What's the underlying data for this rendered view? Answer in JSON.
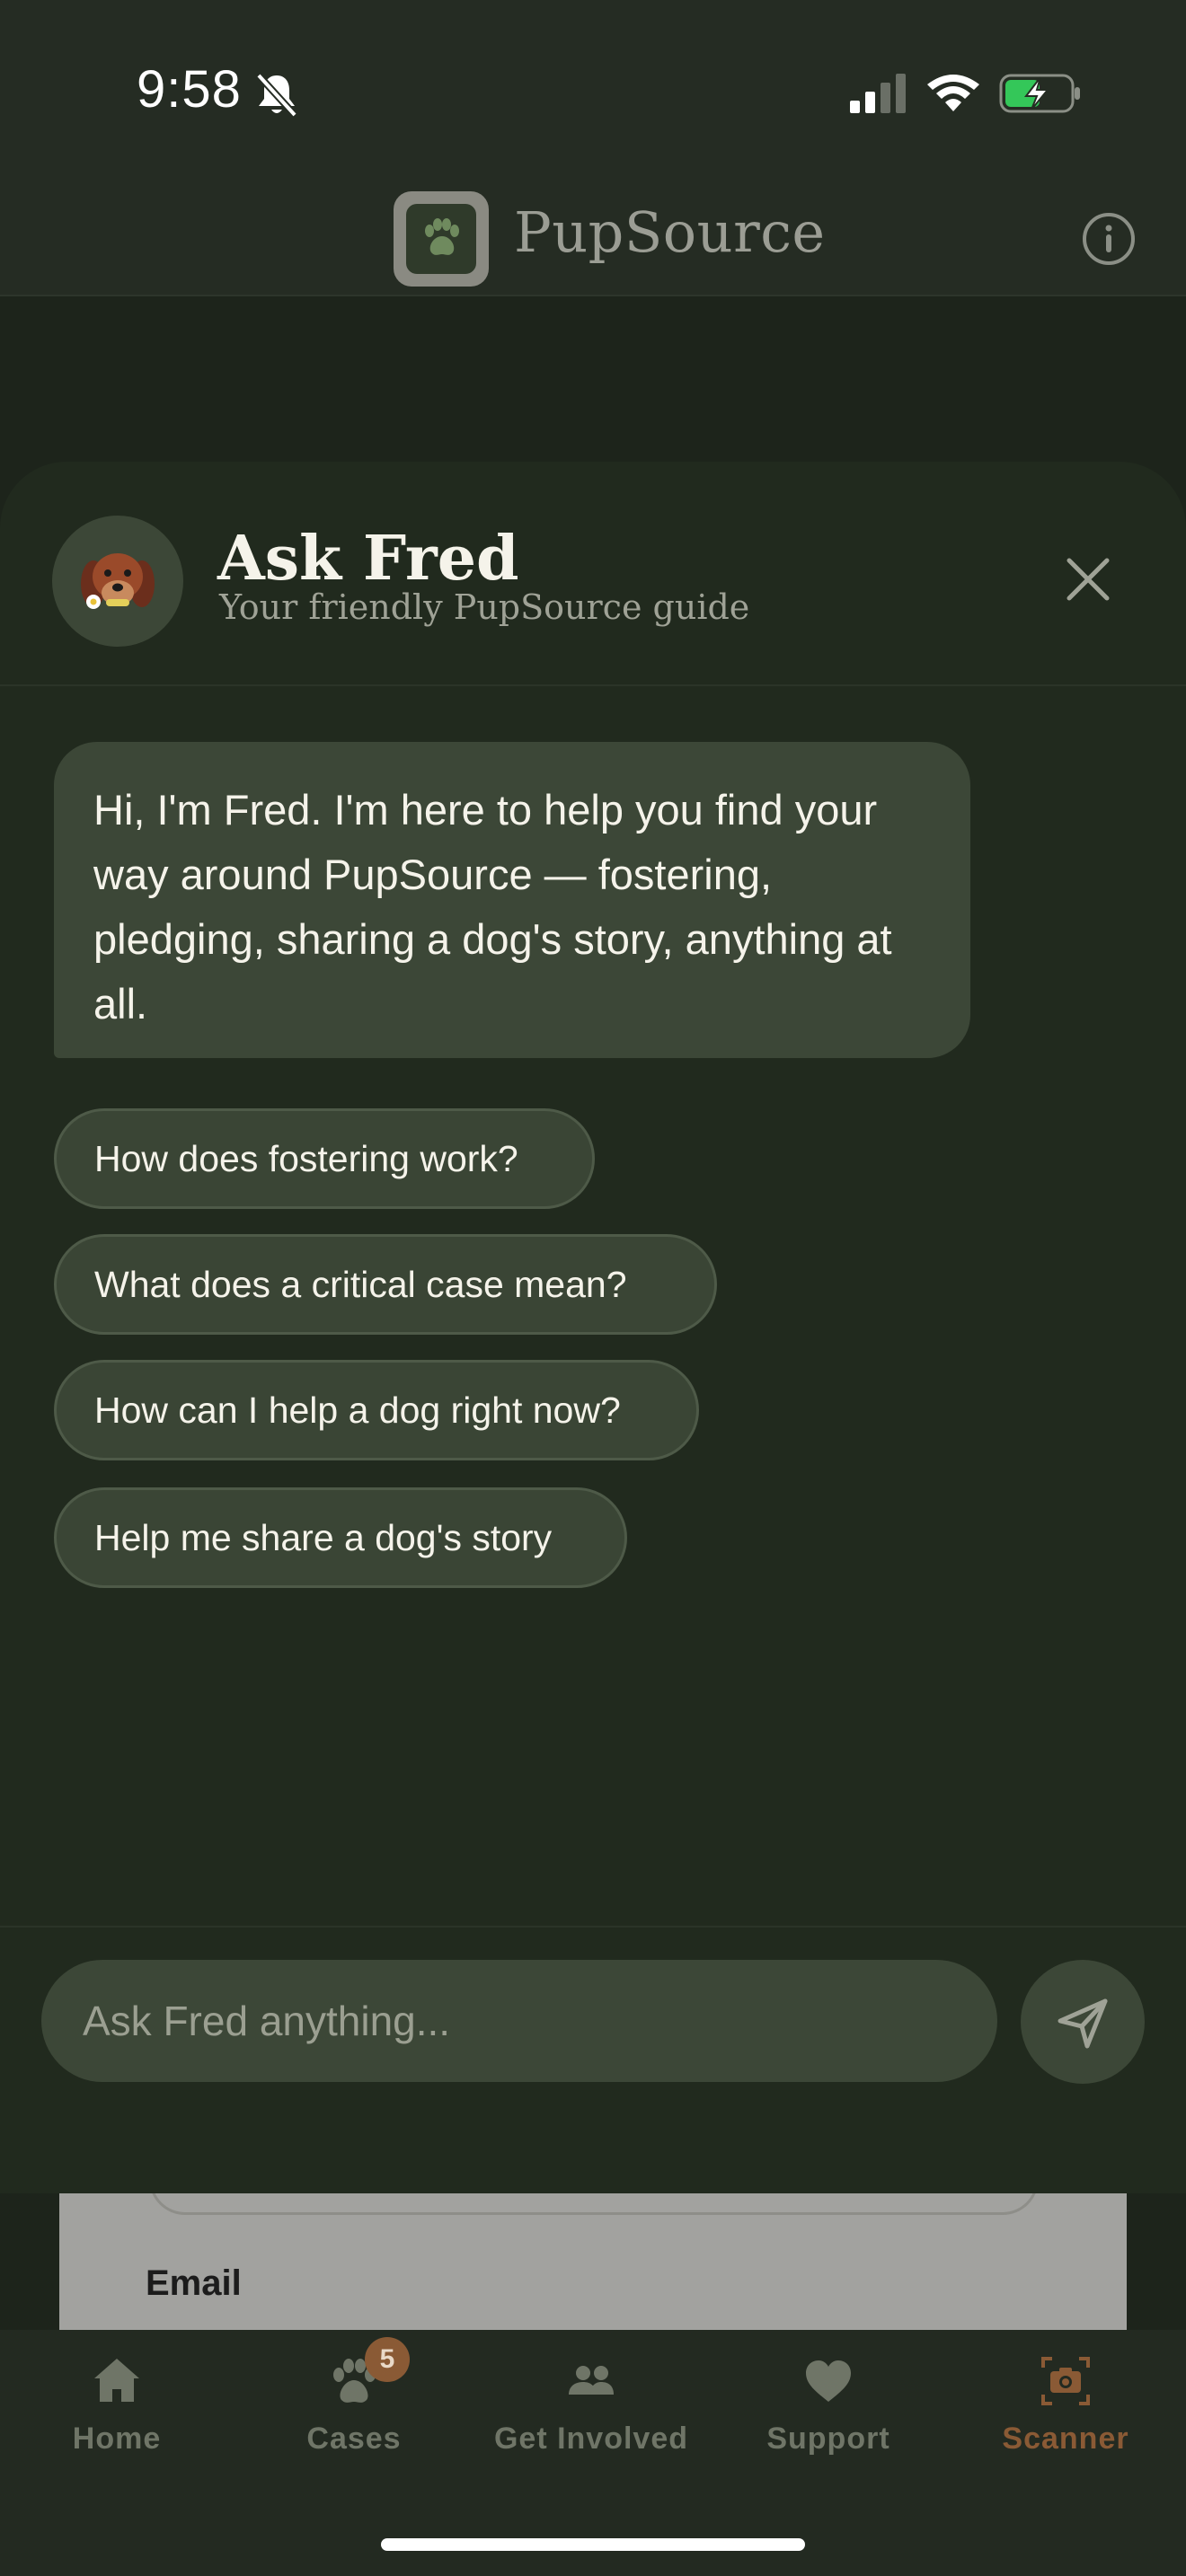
{
  "status_bar": {
    "time": "9:58"
  },
  "header": {
    "app_name": "PupSource"
  },
  "sheet": {
    "title": "Ask Fred",
    "subtitle": "Your friendly PupSource guide",
    "message": "Hi, I'm Fred. I'm here to help you find your way around PupSource — fostering, pledging, sharing a dog's story, anything at all.",
    "suggestions": [
      "How does fostering work?",
      "What does a critical case mean?",
      "How can I help a dog right now?",
      "Help me share a dog's story"
    ],
    "input_placeholder": "Ask Fred anything..."
  },
  "background": {
    "field_label": "Email"
  },
  "tabbar": {
    "items": [
      {
        "label": "Home",
        "icon": "home-icon"
      },
      {
        "label": "Cases",
        "icon": "paw-icon",
        "badge": "5"
      },
      {
        "label": "Get Involved",
        "icon": "people-icon"
      },
      {
        "label": "Support",
        "icon": "heart-icon"
      },
      {
        "label": "Scanner",
        "icon": "camera-scan-icon",
        "active": true
      }
    ]
  },
  "colors": {
    "background": "#232a21",
    "sheet": "#212a1e",
    "bubble": "#3c4737",
    "accent": "#8a5a35",
    "inactive_tab": "#6f7567"
  }
}
